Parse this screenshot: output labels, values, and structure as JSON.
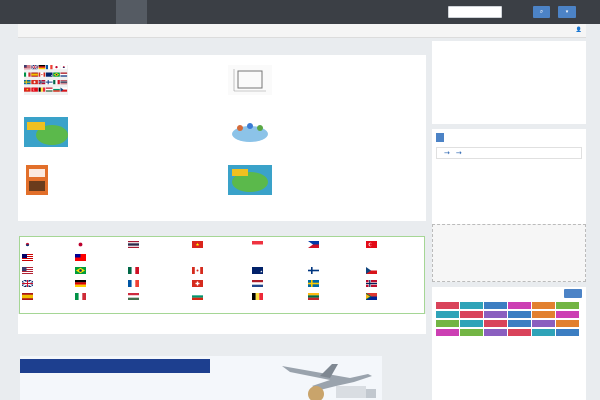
{
  "header": {
    "logo": "",
    "nav": [
      {
        "label": "",
        "active": true
      },
      {
        "label": "",
        "active": false
      },
      {
        "label": "",
        "active": false
      },
      {
        "label": "",
        "active": false
      },
      {
        "label": "",
        "active": false
      },
      {
        "label": "",
        "active": false
      }
    ],
    "search_placeholder": "",
    "search_button": "",
    "menu_button": ""
  },
  "breadcrumb": {
    "current": "",
    "user_link": ""
  },
  "articles": {
    "section_title": "",
    "items": [
      {
        "title": "",
        "desc": "",
        "thumb": "flags-grid"
      },
      {
        "title": "",
        "desc": "",
        "thumb": "box-outline"
      },
      {
        "title": "",
        "desc": "",
        "thumb": "shenzhen-hongkong"
      },
      {
        "title": "",
        "desc": "",
        "thumb": "globe-people"
      },
      {
        "title": "",
        "desc": "",
        "thumb": "book-cover"
      },
      {
        "title": "",
        "desc": "",
        "thumb": "shenzhen-hongkong"
      }
    ]
  },
  "countries": {
    "section_title": "",
    "items": [
      {
        "name": "",
        "flag": "kr"
      },
      {
        "name": "",
        "flag": "jp"
      },
      {
        "name": "",
        "flag": "th"
      },
      {
        "name": "",
        "flag": "vn"
      },
      {
        "name": "",
        "flag": "sg"
      },
      {
        "name": "",
        "flag": "ph"
      },
      {
        "name": "",
        "flag": "tr"
      },
      {
        "name": "",
        "flag": "my"
      },
      {
        "name": "",
        "flag": "tw"
      },
      {
        "name": "",
        "flag": "us"
      },
      {
        "name": "",
        "flag": "br"
      },
      {
        "name": "",
        "flag": "mx"
      },
      {
        "name": "",
        "flag": "ca"
      },
      {
        "name": "",
        "flag": "au"
      },
      {
        "name": "",
        "flag": "fi"
      },
      {
        "name": "",
        "flag": "cz"
      },
      {
        "name": "",
        "flag": "uk"
      },
      {
        "name": "",
        "flag": "de"
      },
      {
        "name": "",
        "flag": "fr"
      },
      {
        "name": "",
        "flag": "ch"
      },
      {
        "name": "",
        "flag": "nl"
      },
      {
        "name": "",
        "flag": "se"
      },
      {
        "name": "",
        "flag": "no"
      },
      {
        "name": "",
        "flag": "es"
      },
      {
        "name": "",
        "flag": "it"
      },
      {
        "name": "",
        "flag": "hu"
      },
      {
        "name": "",
        "flag": "bg"
      },
      {
        "name": "",
        "flag": "be"
      },
      {
        "name": "",
        "flag": "lt"
      },
      {
        "name": "",
        "flag": "za"
      }
    ]
  },
  "services": [
    {
      "label": "",
      "icon": "plane-icon"
    },
    {
      "label": "",
      "icon": "ship-icon"
    },
    {
      "label": "",
      "icon": "package-icon"
    },
    {
      "label": "",
      "icon": "box-icon"
    },
    {
      "label": "",
      "icon": "tools-icon"
    },
    {
      "label": "",
      "icon": "truck-icon"
    }
  ],
  "banner": {
    "section_title": "",
    "headline": "",
    "main": "",
    "sub1": "",
    "sub2": ""
  },
  "sidebar": {
    "ad": {
      "heading": "",
      "slogan": "",
      "taobao_cn": "",
      "taobao_en": "",
      "alipay_cn": "",
      "alipay_en": "",
      "footer": ""
    },
    "service": {
      "heading": "",
      "flow": [
        "",
        "",
        ""
      ],
      "lines": [
        {
          "hl": "",
          "text": ""
        },
        {
          "hl": "",
          "text": ""
        },
        {
          "hl": "",
          "text": ""
        },
        {
          "hl": "",
          "text": ""
        },
        {
          "hl": "",
          "text": ""
        },
        {
          "hl": "",
          "text": ""
        }
      ]
    },
    "ad_placeholder": "",
    "tags": {
      "heading": "",
      "more": "",
      "items": [
        {
          "label": "",
          "color": "#d9435a"
        },
        {
          "label": "",
          "color": "#2fa3b8"
        },
        {
          "label": "",
          "color": "#3c7ec2"
        },
        {
          "label": "",
          "color": "#cc3fb3"
        },
        {
          "label": "",
          "color": "#e2802f"
        },
        {
          "label": "",
          "color": "#73b544"
        },
        {
          "label": "",
          "color": "#2fa3b8"
        },
        {
          "label": "",
          "color": "#d9435a"
        },
        {
          "label": "",
          "color": "#8a5fbf"
        },
        {
          "label": "",
          "color": "#3c7ec2"
        },
        {
          "label": "",
          "color": "#e2802f"
        },
        {
          "label": "",
          "color": "#cc3fb3"
        },
        {
          "label": "",
          "color": "#73b544"
        },
        {
          "label": "",
          "color": "#2fa3b8"
        },
        {
          "label": "",
          "color": "#d9435a"
        },
        {
          "label": "",
          "color": "#3c7ec2"
        },
        {
          "label": "",
          "color": "#8a5fbf"
        },
        {
          "label": "",
          "color": "#e2802f"
        },
        {
          "label": "",
          "color": "#cc3fb3"
        },
        {
          "label": "",
          "color": "#73b544"
        },
        {
          "label": "",
          "color": "#8a5fbf"
        },
        {
          "label": "",
          "color": "#d9435a"
        },
        {
          "label": "",
          "color": "#2fa3b8"
        },
        {
          "label": "",
          "color": "#3c7ec2"
        }
      ]
    }
  },
  "colors": {
    "topbar": "#3b3f45",
    "accent": "#4c83c6",
    "link": "#2a64b0",
    "highlight": "#d02020"
  }
}
